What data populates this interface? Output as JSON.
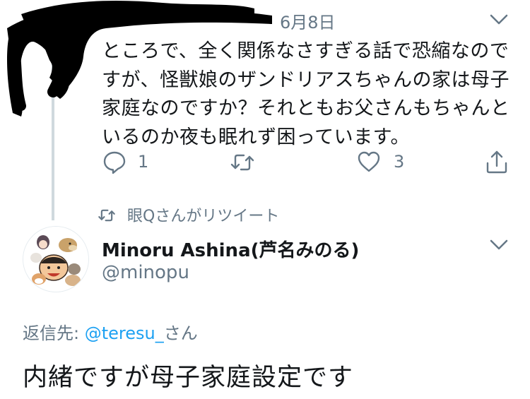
{
  "quoted_tweet": {
    "date": "6月8日",
    "text": "ところで、全く関係なさすぎる話で恐縮なのですが、怪獣娘のザンドリアスちゃんの家は母子家庭なのですか？それともお父さんもちゃんといるのか夜も眠れず困っています。",
    "reply_count": "1",
    "like_count": "3",
    "icons": [
      "chevron-down-icon",
      "reply-icon",
      "retweet-icon",
      "like-icon",
      "share-icon"
    ]
  },
  "retweet_notice": {
    "text": "眼Qさんがリツイート",
    "icon": "retweet-icon"
  },
  "main_tweet": {
    "display_name": "Minoru Ashina(芦名みのる)",
    "handle": "@minopu",
    "reply_prefix": "返信先: ",
    "reply_mention": "@teresu_",
    "reply_suffix": "さん",
    "text": "内緒ですが母子家庭設定です",
    "icons": [
      "chevron-down-icon"
    ]
  },
  "colors": {
    "text": "#14171a",
    "secondary": "#657786",
    "link": "#1da1f2",
    "thread_line": "#cfd9de",
    "redaction": "#000000"
  }
}
